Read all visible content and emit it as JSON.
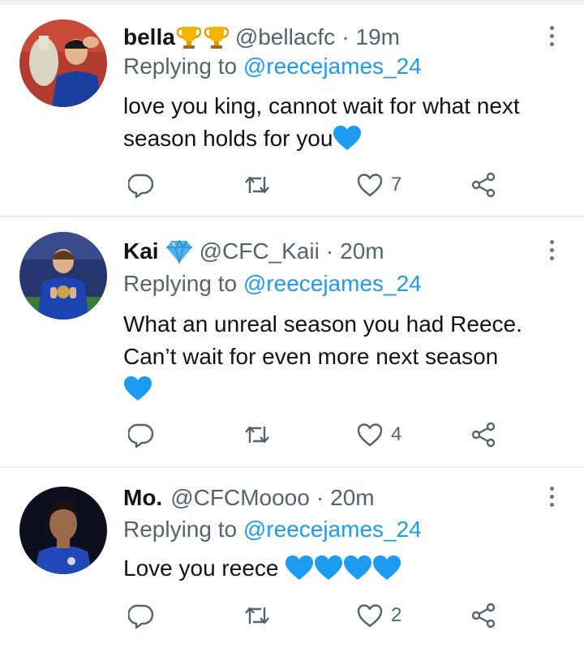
{
  "colors": {
    "link": "#1d9bf0",
    "text": "#0f1419",
    "muted": "#536471",
    "heart_emoji": "#1d9bf0"
  },
  "replies": [
    {
      "name": "bella",
      "badge_icons": [
        "trophy-icon",
        "trophy-icon"
      ],
      "handle": "@bellacfc",
      "dot": "·",
      "time": "19m",
      "replying_prefix": "Replying to ",
      "replying_target": "@reecejames_24",
      "body_lines": [
        "love you king, cannot wait for what next",
        "season holds for you"
      ],
      "emoji_count": 1,
      "like_count": "7"
    },
    {
      "name": "Kai",
      "badge_icons": [
        "diamond-icon"
      ],
      "handle": "@CFC_Kaii",
      "dot": "·",
      "time": "20m",
      "replying_prefix": "Replying to ",
      "replying_target": "@reecejames_24",
      "body_lines": [
        "What an unreal season you had Reece.",
        "Can’t wait for even more next season"
      ],
      "emoji_count": 1,
      "like_count": "4"
    },
    {
      "name": "Mo.",
      "badge_icons": [],
      "handle": "@CFCMoooo",
      "dot": "·",
      "time": "20m",
      "replying_prefix": "Replying to ",
      "replying_target": "@reecejames_24",
      "body_lines": [
        "Love you reece"
      ],
      "emoji_count": 4,
      "like_count": "2"
    }
  ]
}
